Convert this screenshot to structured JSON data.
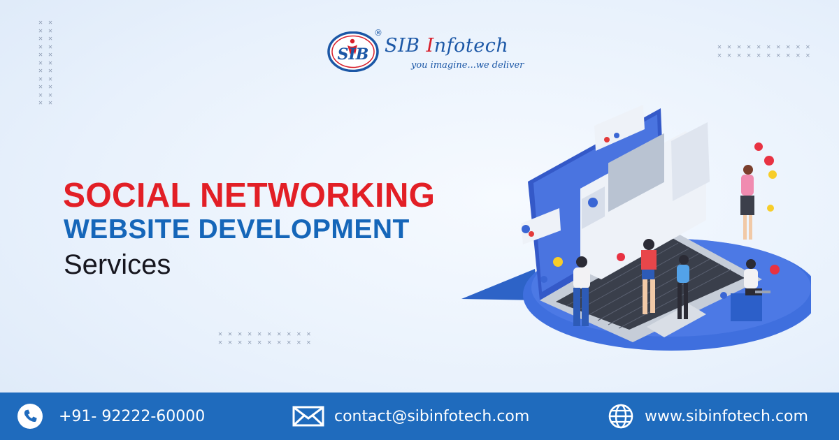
{
  "brand": {
    "badge_text": "SIB",
    "name_first": "SIB ",
    "name_initial": "I",
    "name_rest": "nfotech",
    "tagline": "you imagine...we deliver",
    "registered_mark": "®"
  },
  "headline": {
    "line1": "SOCIAL NETWORKING",
    "line2": "WEBSITE DEVELOPMENT",
    "line3": "Services"
  },
  "footer": {
    "phone": "+91- 92222-60000",
    "email": "contact@sibinfotech.com",
    "website": "www.sibinfotech.com"
  },
  "colors": {
    "accent_red": "#e21f26",
    "accent_blue": "#1566b9",
    "footer_blue": "#1f6bbd"
  },
  "icons": [
    "phone-icon",
    "mail-icon",
    "globe-icon"
  ]
}
